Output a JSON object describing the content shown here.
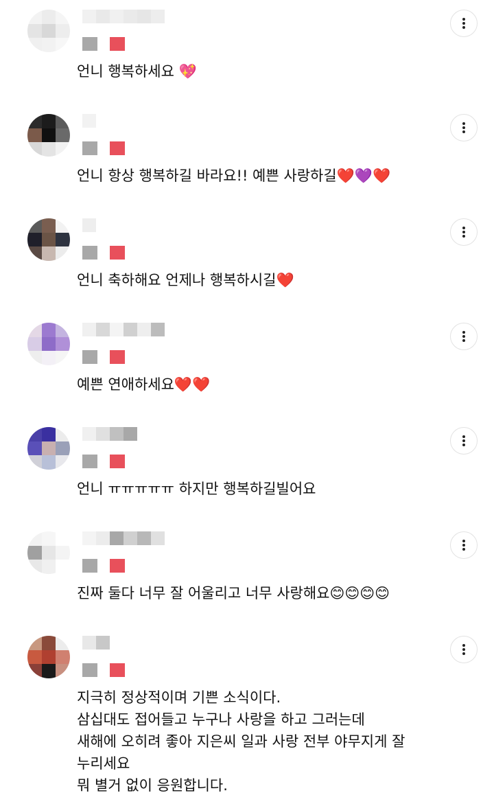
{
  "comments": [
    {
      "text": "언니 행복하세요 💖",
      "more_icon": "more-vertical-icon"
    },
    {
      "text": "언니 항상 행복하길 바라요!! 예쁜 사랑하길❤️💜❤️",
      "more_icon": "more-vertical-icon"
    },
    {
      "text": "언니 축하해요 언제나 행복하시길❤️",
      "more_icon": "more-vertical-icon"
    },
    {
      "text": "예쁜 연애하세요❤️❤️",
      "more_icon": "more-vertical-icon"
    },
    {
      "text": "언니 ㅠㅠㅠㅠㅠ 하지만 행복하길빌어요",
      "more_icon": "more-vertical-icon"
    },
    {
      "text": "진짜 둘다 너무 잘 어울리고 너무 사랑해요😊😊😊😊",
      "more_icon": "more-vertical-icon"
    },
    {
      "text": "지극히 정상적이며 기쁜 소식이다.\n삼십대도 접어들고 누구나 사랑을 하고 그러는데\n새해에 오히려 좋아 지은씨 일과 사랑 전부 야무지게 잘\n누리세요\n뭐 별거 없이 응원합니다.",
      "more_icon": "more-vertical-icon"
    }
  ],
  "colors": {
    "mosaic_red": "#e8505b",
    "mosaic_gray": "#a8a8a8",
    "button_border": "#e2e2e2"
  }
}
